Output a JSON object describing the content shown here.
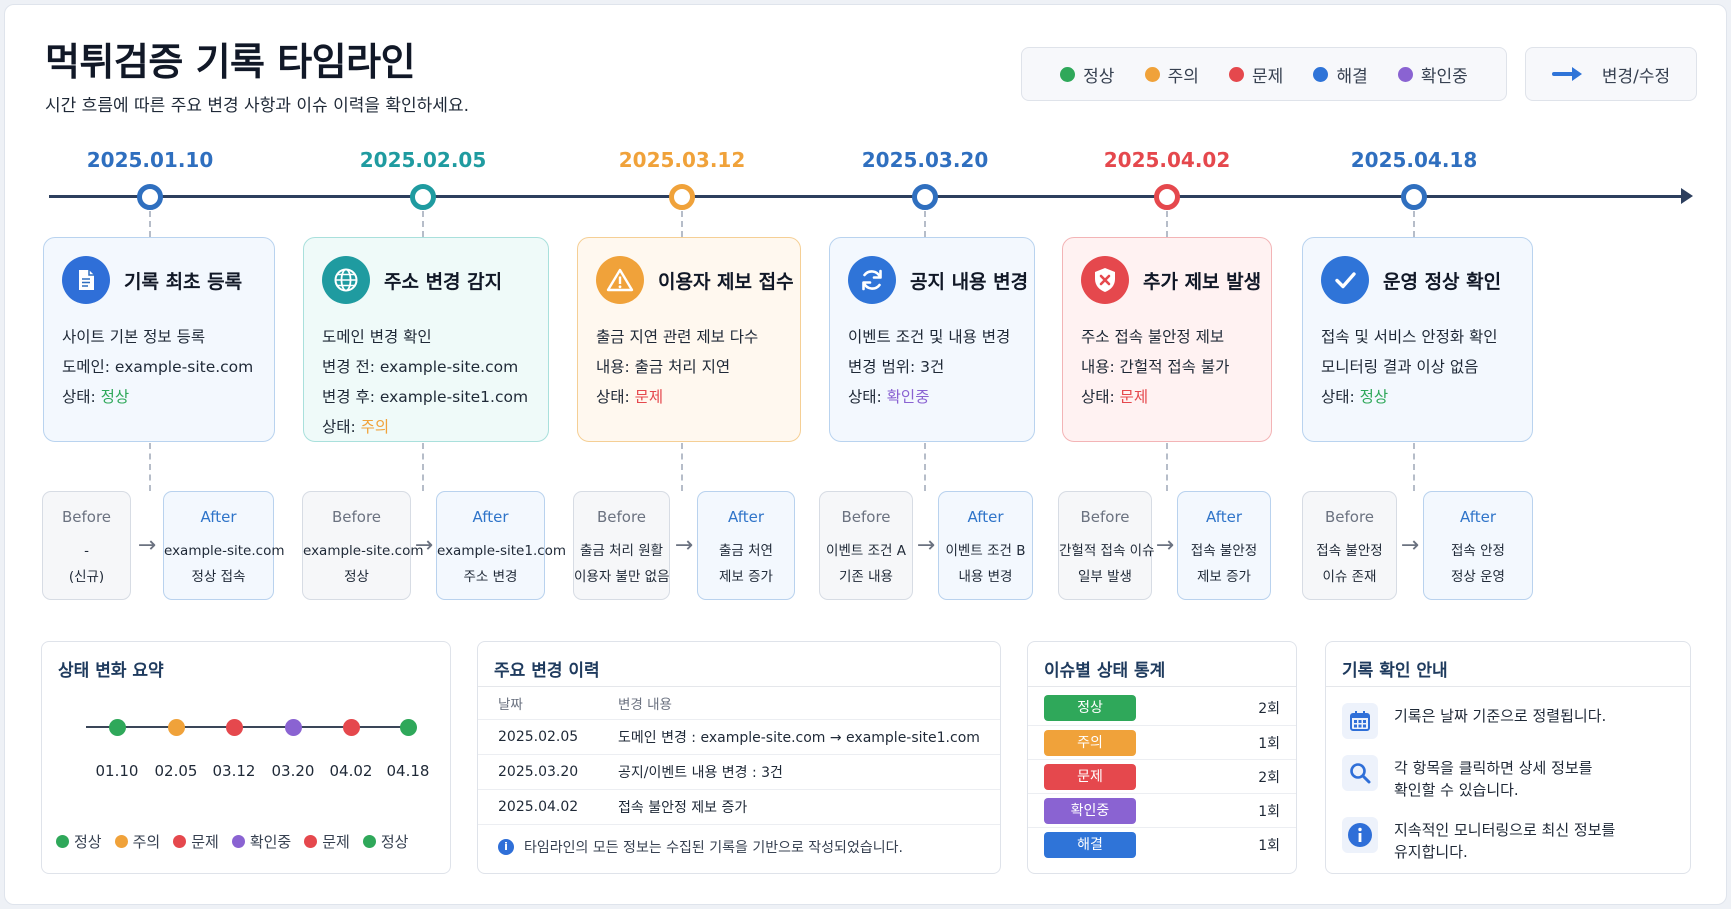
{
  "header": {
    "title": "먹튀검증 기록 타임라인",
    "subtitle": "시간 흐름에 따른 주요 변경 사항과 이슈 이력을 확인하세요."
  },
  "legend": [
    {
      "label": "정상",
      "color": "#2fa85a"
    },
    {
      "label": "주의",
      "color": "#f0a23a"
    },
    {
      "label": "문제",
      "color": "#e5484d"
    },
    {
      "label": "해결",
      "color": "#2f74d8"
    },
    {
      "label": "확인중",
      "color": "#8a63d2"
    }
  ],
  "change_legend": {
    "label": "변경/수정",
    "icon": "arrow-right-icon"
  },
  "events": [
    {
      "date": "2025.01.10",
      "color": "#2f6fbf",
      "title": "기록 최초 등록",
      "icon": "document-icon",
      "lines": [
        "사이트 기본 정보 등록",
        "도메인: example-site.com"
      ],
      "status_prefix": "상태: ",
      "status": "정상",
      "status_color": "#2fa85a",
      "before": {
        "label": "Before",
        "lines": [
          "-",
          "(신규)"
        ]
      },
      "after": {
        "label": "After",
        "lines": [
          "example-site.com",
          "정상 접속"
        ]
      }
    },
    {
      "date": "2025.02.05",
      "color": "#1f9ba0",
      "title": "주소 변경 감지",
      "icon": "globe-icon",
      "lines": [
        "도메인 변경 확인",
        "변경 전: example-site.com",
        "변경 후: example-site1.com"
      ],
      "status_prefix": "상태: ",
      "status": "주의",
      "status_color": "#f0a23a",
      "before": {
        "label": "Before",
        "lines": [
          "example-site.com",
          "정상"
        ]
      },
      "after": {
        "label": "After",
        "lines": [
          "example-site1.com",
          "주소 변경"
        ]
      }
    },
    {
      "date": "2025.03.12",
      "color": "#f0a23a",
      "title": "이용자 제보 접수",
      "icon": "warning-icon",
      "lines": [
        "출금 지연 관련 제보 다수",
        "내용: 출금 처리 지연"
      ],
      "status_prefix": "상태: ",
      "status": "문제",
      "status_color": "#e5484d",
      "before": {
        "label": "Before",
        "lines": [
          "출금 처리 원활",
          "이용자 불만 없음"
        ]
      },
      "after": {
        "label": "After",
        "lines": [
          "출금 처연",
          "제보 증가"
        ]
      }
    },
    {
      "date": "2025.03.20",
      "color": "#2f6fbf",
      "title": "공지 내용 변경",
      "icon": "refresh-icon",
      "lines": [
        "이벤트 조건 및 내용 변경",
        "변경 범위: 3건"
      ],
      "status_prefix": "상태: ",
      "status": "확인중",
      "status_color": "#8a63d2",
      "before": {
        "label": "Before",
        "lines": [
          "이벤트 조건 A",
          "기존 내용"
        ]
      },
      "after": {
        "label": "After",
        "lines": [
          "이벤트 조건 B",
          "내용 변경"
        ]
      }
    },
    {
      "date": "2025.04.02",
      "color": "#e5484d",
      "title": "추가 제보 발생",
      "icon": "shield-alert-icon",
      "lines": [
        "주소 접속 불안정 제보",
        "내용: 간헐적 접속 불가"
      ],
      "status_prefix": "상태: ",
      "status": "문제",
      "status_color": "#e5484d",
      "before": {
        "label": "Before",
        "lines": [
          "간헐적 접속 이슈",
          "일부 발생"
        ]
      },
      "after": {
        "label": "After",
        "lines": [
          "접속 불안정",
          "제보 증가"
        ]
      }
    },
    {
      "date": "2025.04.18",
      "color": "#2f6fbf",
      "title": "운영 정상 확인",
      "icon": "check-icon",
      "lines": [
        "접속 및 서비스 안정화 확인",
        "모니터링 결과 이상 없음"
      ],
      "status_prefix": "상태: ",
      "status": "정상",
      "status_color": "#2fa85a",
      "before": {
        "label": "Before",
        "lines": [
          "접속 불안정",
          "이슈 존재"
        ]
      },
      "after": {
        "label": "After",
        "lines": [
          "접속 안정",
          "정상 운영"
        ]
      }
    }
  ],
  "summary": {
    "title": "상태 변화 요약",
    "points": [
      {
        "date": "01.10",
        "color": "#2fa85a"
      },
      {
        "date": "02.05",
        "color": "#f0a23a"
      },
      {
        "date": "03.12",
        "color": "#e5484d"
      },
      {
        "date": "03.20",
        "color": "#8a63d2"
      },
      {
        "date": "04.02",
        "color": "#e5484d"
      },
      {
        "date": "04.18",
        "color": "#2fa85a"
      }
    ],
    "legend": [
      {
        "label": "정상",
        "color": "#2fa85a"
      },
      {
        "label": "주의",
        "color": "#f0a23a"
      },
      {
        "label": "문제",
        "color": "#e5484d"
      },
      {
        "label": "확인중",
        "color": "#8a63d2"
      },
      {
        "label": "문제",
        "color": "#e5484d"
      },
      {
        "label": "정상",
        "color": "#2fa85a"
      }
    ]
  },
  "history": {
    "title": "주요 변경 이력",
    "headers": [
      "날짜",
      "변경 내용"
    ],
    "rows": [
      [
        "2025.02.05",
        "도메인 변경 : example-site.com → example-site1.com"
      ],
      [
        "2025.03.20",
        "공지/이벤트 내용 변경 : 3건"
      ],
      [
        "2025.04.02",
        "접속 불안정 제보 증가"
      ]
    ],
    "note": "타임라인의 모든 정보는 수집된 기록을 기반으로 작성되었습니다."
  },
  "stats": {
    "title": "이슈별 상태 통계",
    "rows": [
      {
        "label": "정상",
        "count": "2회",
        "color": "#2fa85a"
      },
      {
        "label": "주의",
        "count": "1회",
        "color": "#f0a23a"
      },
      {
        "label": "문제",
        "count": "2회",
        "color": "#e5484d"
      },
      {
        "label": "확인중",
        "count": "1회",
        "color": "#8a63d2"
      },
      {
        "label": "해결",
        "count": "1회",
        "color": "#2f74d8"
      }
    ]
  },
  "guide": {
    "title": "기록 확인 안내",
    "items": [
      {
        "icon": "calendar-icon",
        "text": "기록은 날짜 기준으로 정렬됩니다."
      },
      {
        "icon": "search-icon",
        "text": "각 항목을 클릭하면 상세 정보를\n확인할 수 있습니다."
      },
      {
        "icon": "info-icon",
        "text": "지속적인 모니터링으로 최신 정보를\n유지합니다."
      }
    ]
  }
}
